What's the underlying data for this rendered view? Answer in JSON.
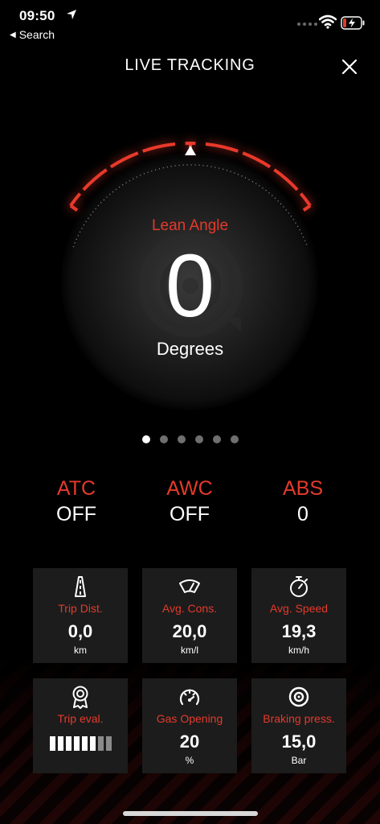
{
  "status_bar": {
    "time": "09:50",
    "back_label": "Search"
  },
  "header": {
    "title": "LIVE TRACKING"
  },
  "gauge": {
    "label": "Lean Angle",
    "value": "0",
    "unit": "Degrees"
  },
  "pager": {
    "count": 6,
    "active": 0
  },
  "systems": [
    {
      "label": "ATC",
      "value": "OFF"
    },
    {
      "label": "AWC",
      "value": "OFF"
    },
    {
      "label": "ABS",
      "value": "0"
    }
  ],
  "tiles": [
    {
      "icon": "road-icon",
      "label": "Trip Dist.",
      "value": "0,0",
      "unit": "km"
    },
    {
      "icon": "fuel-gauge-icon",
      "label": "Avg. Cons.",
      "value": "20,0",
      "unit": "km/l"
    },
    {
      "icon": "stopwatch-icon",
      "label": "Avg. Speed",
      "value": "19,3",
      "unit": "km/h"
    },
    {
      "icon": "award-icon",
      "label": "Trip eval.",
      "rating_filled": 6,
      "rating_total": 8
    },
    {
      "icon": "throttle-icon",
      "label": "Gas Opening",
      "value": "20",
      "unit": "%"
    },
    {
      "icon": "brake-disc-icon",
      "label": "Braking press.",
      "value": "15,0",
      "unit": "Bar"
    }
  ],
  "colors": {
    "accent": "#e43a2c",
    "tile_bg": "#1c1c1c",
    "background": "#000000"
  }
}
